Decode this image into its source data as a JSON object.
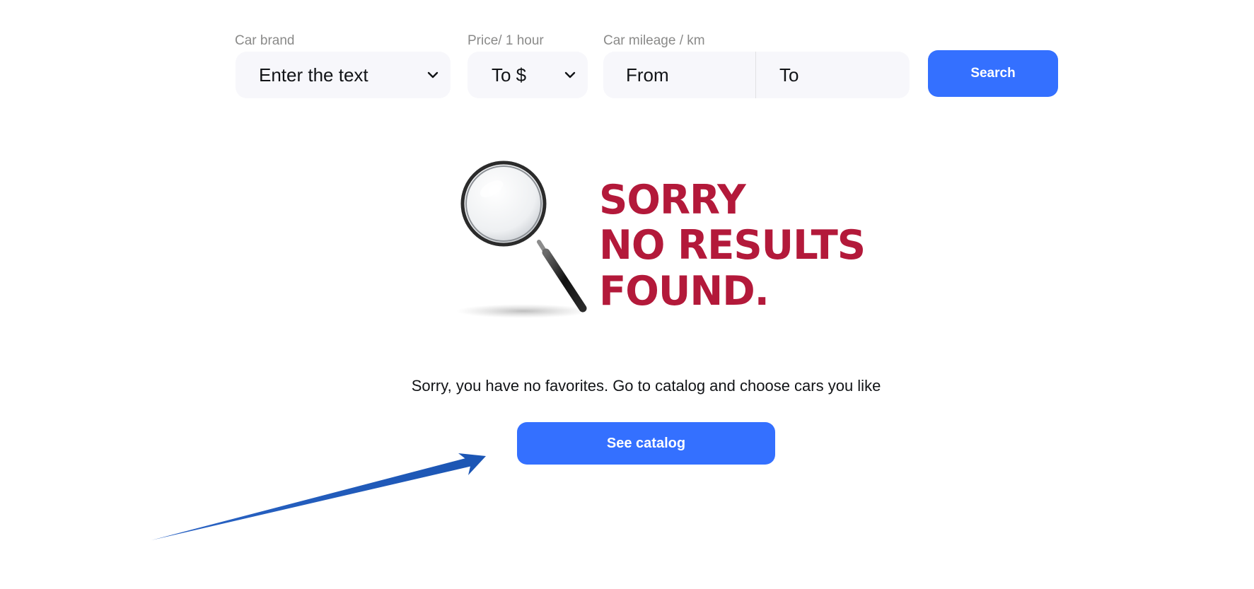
{
  "filters": {
    "brand": {
      "label": "Car brand",
      "value": "Enter the text"
    },
    "price": {
      "label": "Price/ 1 hour",
      "value": "To $"
    },
    "mileage": {
      "label": "Car mileage / km",
      "from_placeholder": "From",
      "to_placeholder": "To"
    },
    "search_label": "Search"
  },
  "empty_state": {
    "image_lines": [
      "SORRY",
      "NO RESULTS",
      "FOUND."
    ],
    "message": "Sorry, you have no favorites. Go to catalog and choose cars you like",
    "catalog_button_label": "See catalog"
  },
  "colors": {
    "accent": "#3470ff",
    "input_bg": "#f7f7fb",
    "label": "#8a8a89",
    "sorry_red": "#b3193a",
    "annotation_arrow": "#1f5fbd"
  },
  "icons": {
    "select_chevron": "chevron-down-icon",
    "illustration": "magnifying-glass-icon",
    "annotation": "arrow-icon"
  }
}
